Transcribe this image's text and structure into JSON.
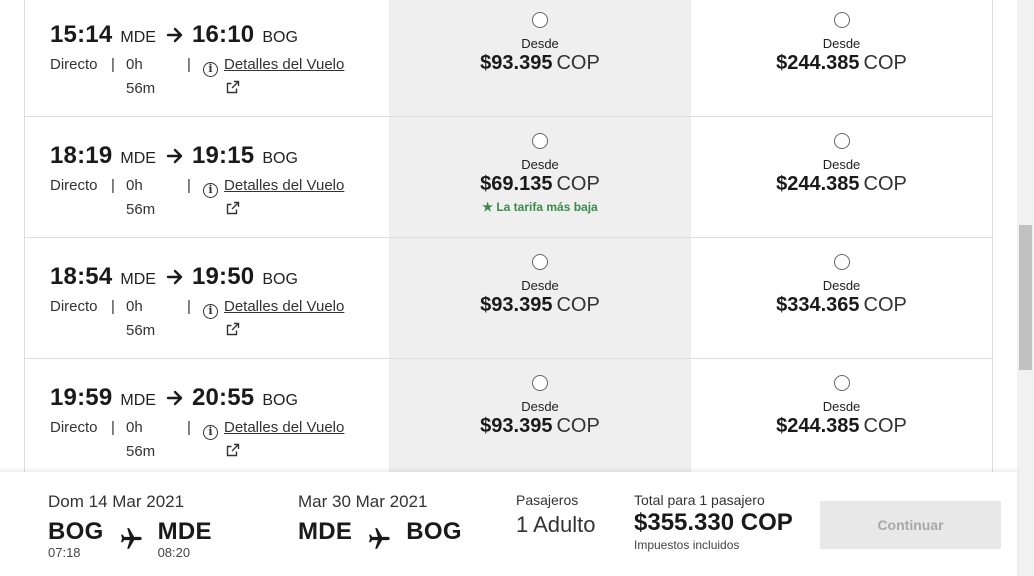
{
  "flights": [
    {
      "dep_time": "15:14",
      "dep_code": "MDE",
      "arr_time": "16:10",
      "arr_code": "BOG",
      "type": "Directo",
      "duration_a": "0h",
      "duration_b": "56m",
      "details": "Detalles del Vuelo",
      "fare1": {
        "desde": "Desde",
        "amount": "$93.395",
        "currency": "COP",
        "note": ""
      },
      "fare2": {
        "desde": "Desde",
        "amount": "$244.385",
        "currency": "COP"
      }
    },
    {
      "dep_time": "18:19",
      "dep_code": "MDE",
      "arr_time": "19:15",
      "arr_code": "BOG",
      "type": "Directo",
      "duration_a": "0h",
      "duration_b": "56m",
      "details": "Detalles del Vuelo",
      "fare1": {
        "desde": "Desde",
        "amount": "$69.135",
        "currency": "COP",
        "note": "★ La tarifa más baja"
      },
      "fare2": {
        "desde": "Desde",
        "amount": "$244.385",
        "currency": "COP"
      }
    },
    {
      "dep_time": "18:54",
      "dep_code": "MDE",
      "arr_time": "19:50",
      "arr_code": "BOG",
      "type": "Directo",
      "duration_a": "0h",
      "duration_b": "56m",
      "details": "Detalles del Vuelo",
      "fare1": {
        "desde": "Desde",
        "amount": "$93.395",
        "currency": "COP",
        "note": ""
      },
      "fare2": {
        "desde": "Desde",
        "amount": "$334.365",
        "currency": "COP"
      }
    },
    {
      "dep_time": "19:59",
      "dep_code": "MDE",
      "arr_time": "20:55",
      "arr_code": "BOG",
      "type": "Directo",
      "duration_a": "0h",
      "duration_b": "56m",
      "details": "Detalles del Vuelo",
      "fare1": {
        "desde": "Desde",
        "amount": "$93.395",
        "currency": "COP",
        "note": ""
      },
      "fare2": {
        "desde": "Desde",
        "amount": "$244.385",
        "currency": "COP"
      }
    }
  ],
  "footer": {
    "outbound": {
      "date": "Dom 14 Mar 2021",
      "from": "BOG",
      "from_time": "07:18",
      "to": "MDE",
      "to_time": "08:20"
    },
    "return": {
      "date": "Mar 30 Mar 2021",
      "from": "MDE",
      "to": "BOG"
    },
    "passengers_label": "Pasajeros",
    "passengers_value": "1 Adulto",
    "total_label": "Total para 1 pasajero",
    "total_value": "$355.330 COP",
    "tax_note": "Impuestos incluidos",
    "continue_label": "Continuar"
  },
  "colors": {
    "fare_column_bg": "#efefef",
    "lowest_fare_green": "#3a8a4a",
    "button_disabled": "#e8e8e8"
  },
  "icons": {
    "arrow": "arrow-right-icon",
    "info": "info-icon",
    "external": "external-link-icon",
    "plane": "plane-icon",
    "radio": "radio-button"
  }
}
